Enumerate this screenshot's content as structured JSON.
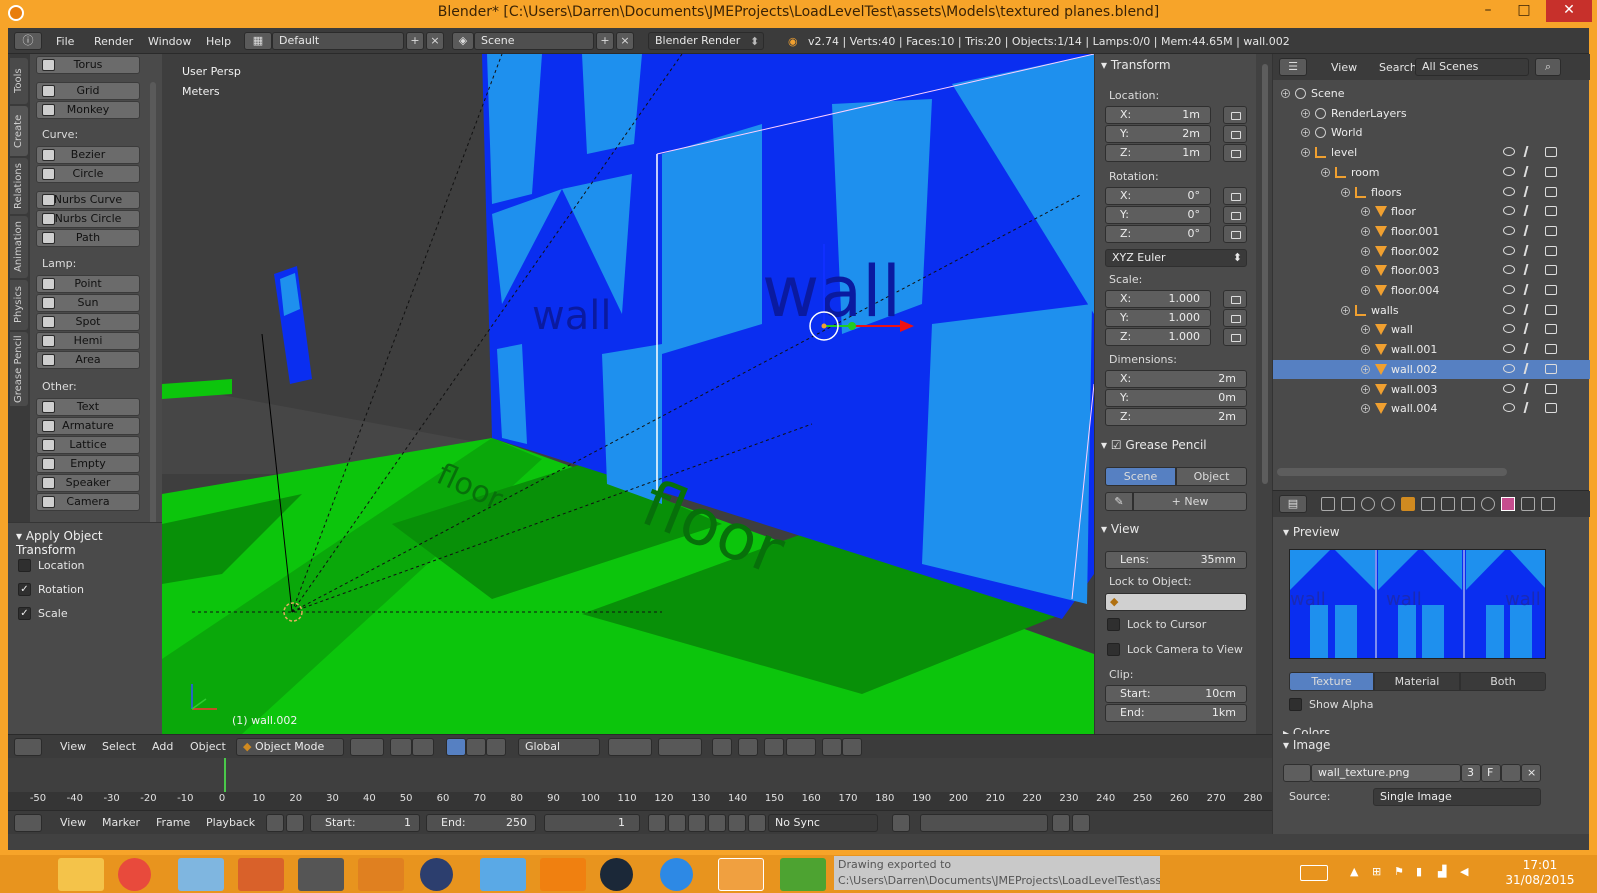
{
  "window": {
    "title": "Blender* [C:\\Users\\Darren\\Documents\\JMEProjects\\LoadLevelTest\\assets\\Models\\textured planes.blend]",
    "min": "–",
    "max": "□",
    "close": "✕"
  },
  "infobar": {
    "menus": [
      "File",
      "Render",
      "Window",
      "Help"
    ],
    "layout": "Default",
    "scene": "Scene",
    "engine": "Blender Render",
    "stats": "v2.74 | Verts:40 | Faces:10 | Tris:20 | Objects:1/14 | Lamps:0/0 | Mem:44.65M | wall.002"
  },
  "toolshelf": {
    "tabs": [
      "Tools",
      "Create",
      "Relations",
      "Animation",
      "Physics",
      "Grease Pencil"
    ],
    "top_buttons": [
      "Torus",
      "Grid",
      "Monkey"
    ],
    "curve_label": "Curve:",
    "curve_buttons": [
      "Bezier",
      "Circle",
      "Nurbs Curve",
      "Nurbs Circle",
      "Path"
    ],
    "lamp_label": "Lamp:",
    "lamp_buttons": [
      "Point",
      "Sun",
      "Spot",
      "Hemi",
      "Area"
    ],
    "other_label": "Other:",
    "other_buttons": [
      "Text",
      "Armature",
      "Lattice",
      "Empty",
      "Speaker",
      "Camera"
    ]
  },
  "operator": {
    "title": "Apply Object Transform",
    "options": [
      {
        "label": "Location",
        "checked": false
      },
      {
        "label": "Rotation",
        "checked": true
      },
      {
        "label": "Scale",
        "checked": true
      }
    ]
  },
  "viewport": {
    "view": "User Persp",
    "units": "Meters",
    "object": "(1) wall.002",
    "wall_text": "wall",
    "floor_text": "floor"
  },
  "npanel": {
    "transform": "Transform",
    "location_label": "Location:",
    "location": {
      "x": "1m",
      "y": "2m",
      "z": "1m"
    },
    "rotation_label": "Rotation:",
    "rotation": {
      "x": "0°",
      "y": "0°",
      "z": "0°"
    },
    "rotation_mode": "XYZ Euler",
    "scale_label": "Scale:",
    "scale": {
      "x": "1.000",
      "y": "1.000",
      "z": "1.000"
    },
    "dimensions_label": "Dimensions:",
    "dimensions": {
      "x": "2m",
      "y": "0m",
      "z": "2m"
    },
    "axis": {
      "x": "X:",
      "y": "Y:",
      "z": "Z:"
    },
    "grease_pencil": "Grease Pencil",
    "gp_scene": "Scene",
    "gp_object": "Object",
    "gp_new": "New",
    "view": "View",
    "lens_label": "Lens:",
    "lens": "35mm",
    "lock_object": "Lock to Object:",
    "lock_cursor": "Lock to Cursor",
    "lock_camera": "Lock Camera to View",
    "clip": "Clip:",
    "clip_start_label": "Start:",
    "clip_start": "10cm",
    "clip_end_label": "End:",
    "clip_end": "1km"
  },
  "outliner": {
    "view": "View",
    "search": "Search",
    "filter": "All Scenes",
    "rows": [
      {
        "name": "Scene",
        "depth": 0,
        "selected": false
      },
      {
        "name": "RenderLayers",
        "depth": 1,
        "selected": false
      },
      {
        "name": "World",
        "depth": 1,
        "selected": false
      },
      {
        "name": "level",
        "depth": 1,
        "selected": false
      },
      {
        "name": "room",
        "depth": 2,
        "selected": false
      },
      {
        "name": "floors",
        "depth": 3,
        "selected": false
      },
      {
        "name": "floor",
        "depth": 4,
        "selected": false
      },
      {
        "name": "floor.001",
        "depth": 4,
        "selected": false
      },
      {
        "name": "floor.002",
        "depth": 4,
        "selected": false
      },
      {
        "name": "floor.003",
        "depth": 4,
        "selected": false
      },
      {
        "name": "floor.004",
        "depth": 4,
        "selected": false
      },
      {
        "name": "walls",
        "depth": 3,
        "selected": false
      },
      {
        "name": "wall",
        "depth": 4,
        "selected": false
      },
      {
        "name": "wall.001",
        "depth": 4,
        "selected": false
      },
      {
        "name": "wall.002",
        "depth": 4,
        "selected": true
      },
      {
        "name": "wall.003",
        "depth": 4,
        "selected": false
      },
      {
        "name": "wall.004",
        "depth": 4,
        "selected": false
      }
    ]
  },
  "properties": {
    "preview": "Preview",
    "modes": [
      "Texture",
      "Material",
      "Both"
    ],
    "show_alpha": "Show Alpha",
    "colors": "Colors",
    "image": "Image",
    "image_name": "wall_texture.png",
    "users": "3",
    "fake": "F",
    "source_label": "Source:",
    "source": "Single Image",
    "preview_text": "wall"
  },
  "vp_header": {
    "menus": [
      "View",
      "Select",
      "Add",
      "Object"
    ],
    "mode": "Object Mode",
    "orientation": "Global"
  },
  "timeline": {
    "ticks": [
      -50,
      -40,
      -30,
      -20,
      -10,
      0,
      10,
      20,
      30,
      40,
      50,
      60,
      70,
      80,
      90,
      100,
      110,
      120,
      130,
      140,
      150,
      160,
      170,
      180,
      190,
      200,
      210,
      220,
      230,
      240,
      250,
      260,
      270,
      280
    ],
    "menus": [
      "View",
      "Marker",
      "Frame",
      "Playback"
    ],
    "start_label": "Start:",
    "start": "1",
    "end_label": "End:",
    "end": "250",
    "current": "1",
    "sync": "No Sync"
  },
  "taskbar": {
    "notice": "Drawing exported to C:\\Users\\Darren\\Documents\\JMEProjects\\LoadLevelTest\\assets\\Textures\\wall_texture.png.",
    "time": "17:01",
    "date": "31/08/2015"
  },
  "colors": {
    "wall_dark": "#0a2ef0",
    "wall_light": "#1e90ee",
    "floor_light": "#0cc50c",
    "floor_dark": "#089008",
    "accent": "#f7a429",
    "highlight": "#5680c2"
  }
}
